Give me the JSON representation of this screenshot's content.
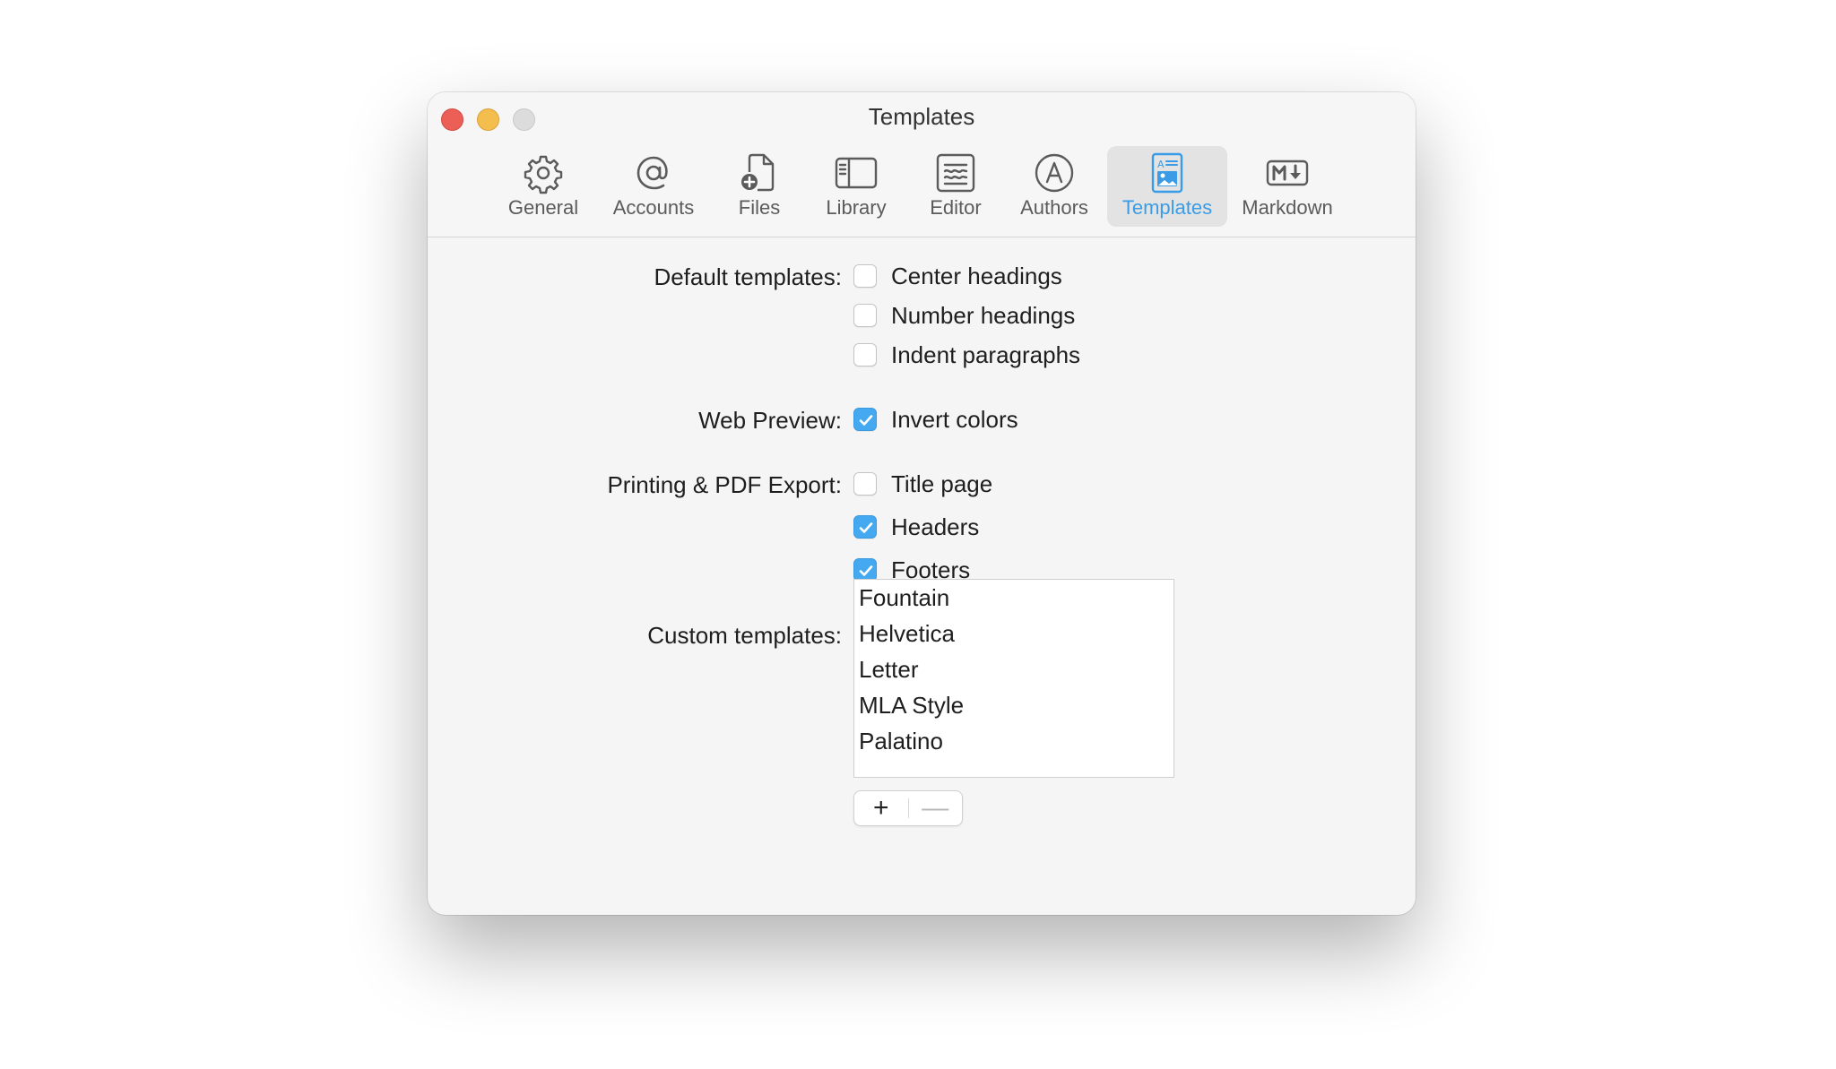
{
  "window": {
    "title": "Templates"
  },
  "toolbar": {
    "items": [
      {
        "label": "General",
        "icon": "gear-icon",
        "active": false
      },
      {
        "label": "Accounts",
        "icon": "at-sign-icon",
        "active": false
      },
      {
        "label": "Files",
        "icon": "new-file-icon",
        "active": false
      },
      {
        "label": "Library",
        "icon": "sidebar-icon",
        "active": false
      },
      {
        "label": "Editor",
        "icon": "editor-icon",
        "active": false
      },
      {
        "label": "Authors",
        "icon": "author-icon",
        "active": false
      },
      {
        "label": "Templates",
        "icon": "template-icon",
        "active": true
      },
      {
        "label": "Markdown",
        "icon": "markdown-icon",
        "active": false
      }
    ],
    "accent_color": "#3a9ce6"
  },
  "default_templates": {
    "label": "Default templates:",
    "options": [
      {
        "label": "Center headings",
        "checked": false
      },
      {
        "label": "Number headings",
        "checked": false
      },
      {
        "label": "Indent paragraphs",
        "checked": false
      }
    ]
  },
  "web_preview": {
    "label": "Web Preview:",
    "options": [
      {
        "label": "Invert colors",
        "checked": true
      }
    ]
  },
  "printing": {
    "label": "Printing & PDF Export:",
    "options": [
      {
        "label": "Title page",
        "checked": false
      },
      {
        "label": "Headers",
        "checked": true
      },
      {
        "label": "Footers",
        "checked": true
      }
    ]
  },
  "custom_templates": {
    "label": "Custom templates:",
    "items": [
      "Fountain",
      "Helvetica",
      "Letter",
      "MLA Style",
      "Palatino"
    ],
    "add_label": "+",
    "remove_label": "—"
  }
}
